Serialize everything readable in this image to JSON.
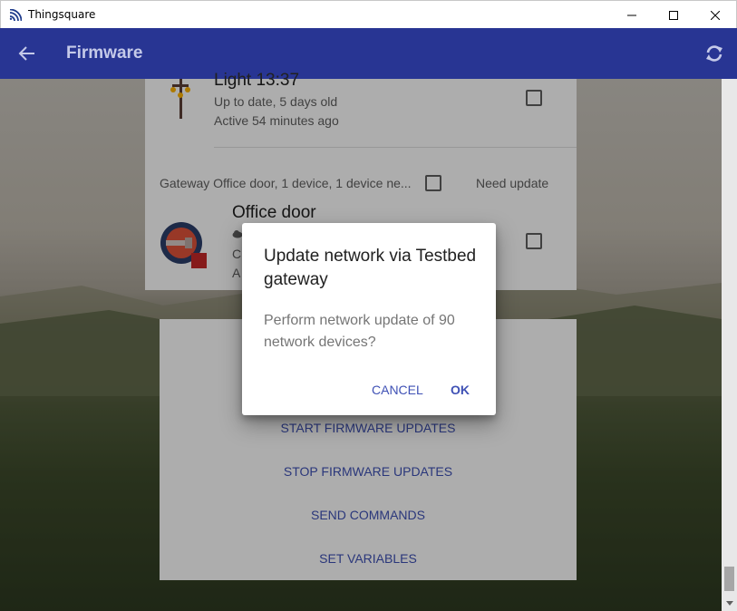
{
  "window": {
    "title": "Thingsquare",
    "controls": {
      "minimize": "minimize-icon",
      "maximize": "maximize-icon",
      "close": "close-icon"
    }
  },
  "toolbar": {
    "title": "Firmware",
    "back_icon": "arrow-left-icon",
    "refresh_icon": "refresh-icon",
    "color": "#283593"
  },
  "devices": [
    {
      "name": "Light 13:37",
      "status": "Up to date, 5 days old",
      "activity": "Active 54 minutes ago",
      "icon": "street-lamp-icon",
      "checked": false
    },
    {
      "name": "Office door",
      "status": "C",
      "activity": "A",
      "icon": "door-lock-icon",
      "checked": false
    }
  ],
  "gateway_row": {
    "label": "Gateway Office door, 1 device, 1 device ne...",
    "status": "Need update",
    "checked": false
  },
  "actions": [
    "START FIRMWARE UPDATES",
    "STOP FIRMWARE UPDATES",
    "SEND COMMANDS",
    "SET VARIABLES"
  ],
  "dialog": {
    "title": "Update network via Testbed gateway",
    "body": "Perform network update of 90 network devices?",
    "cancel": "CANCEL",
    "ok": "OK",
    "accent": "#3f51b5"
  }
}
